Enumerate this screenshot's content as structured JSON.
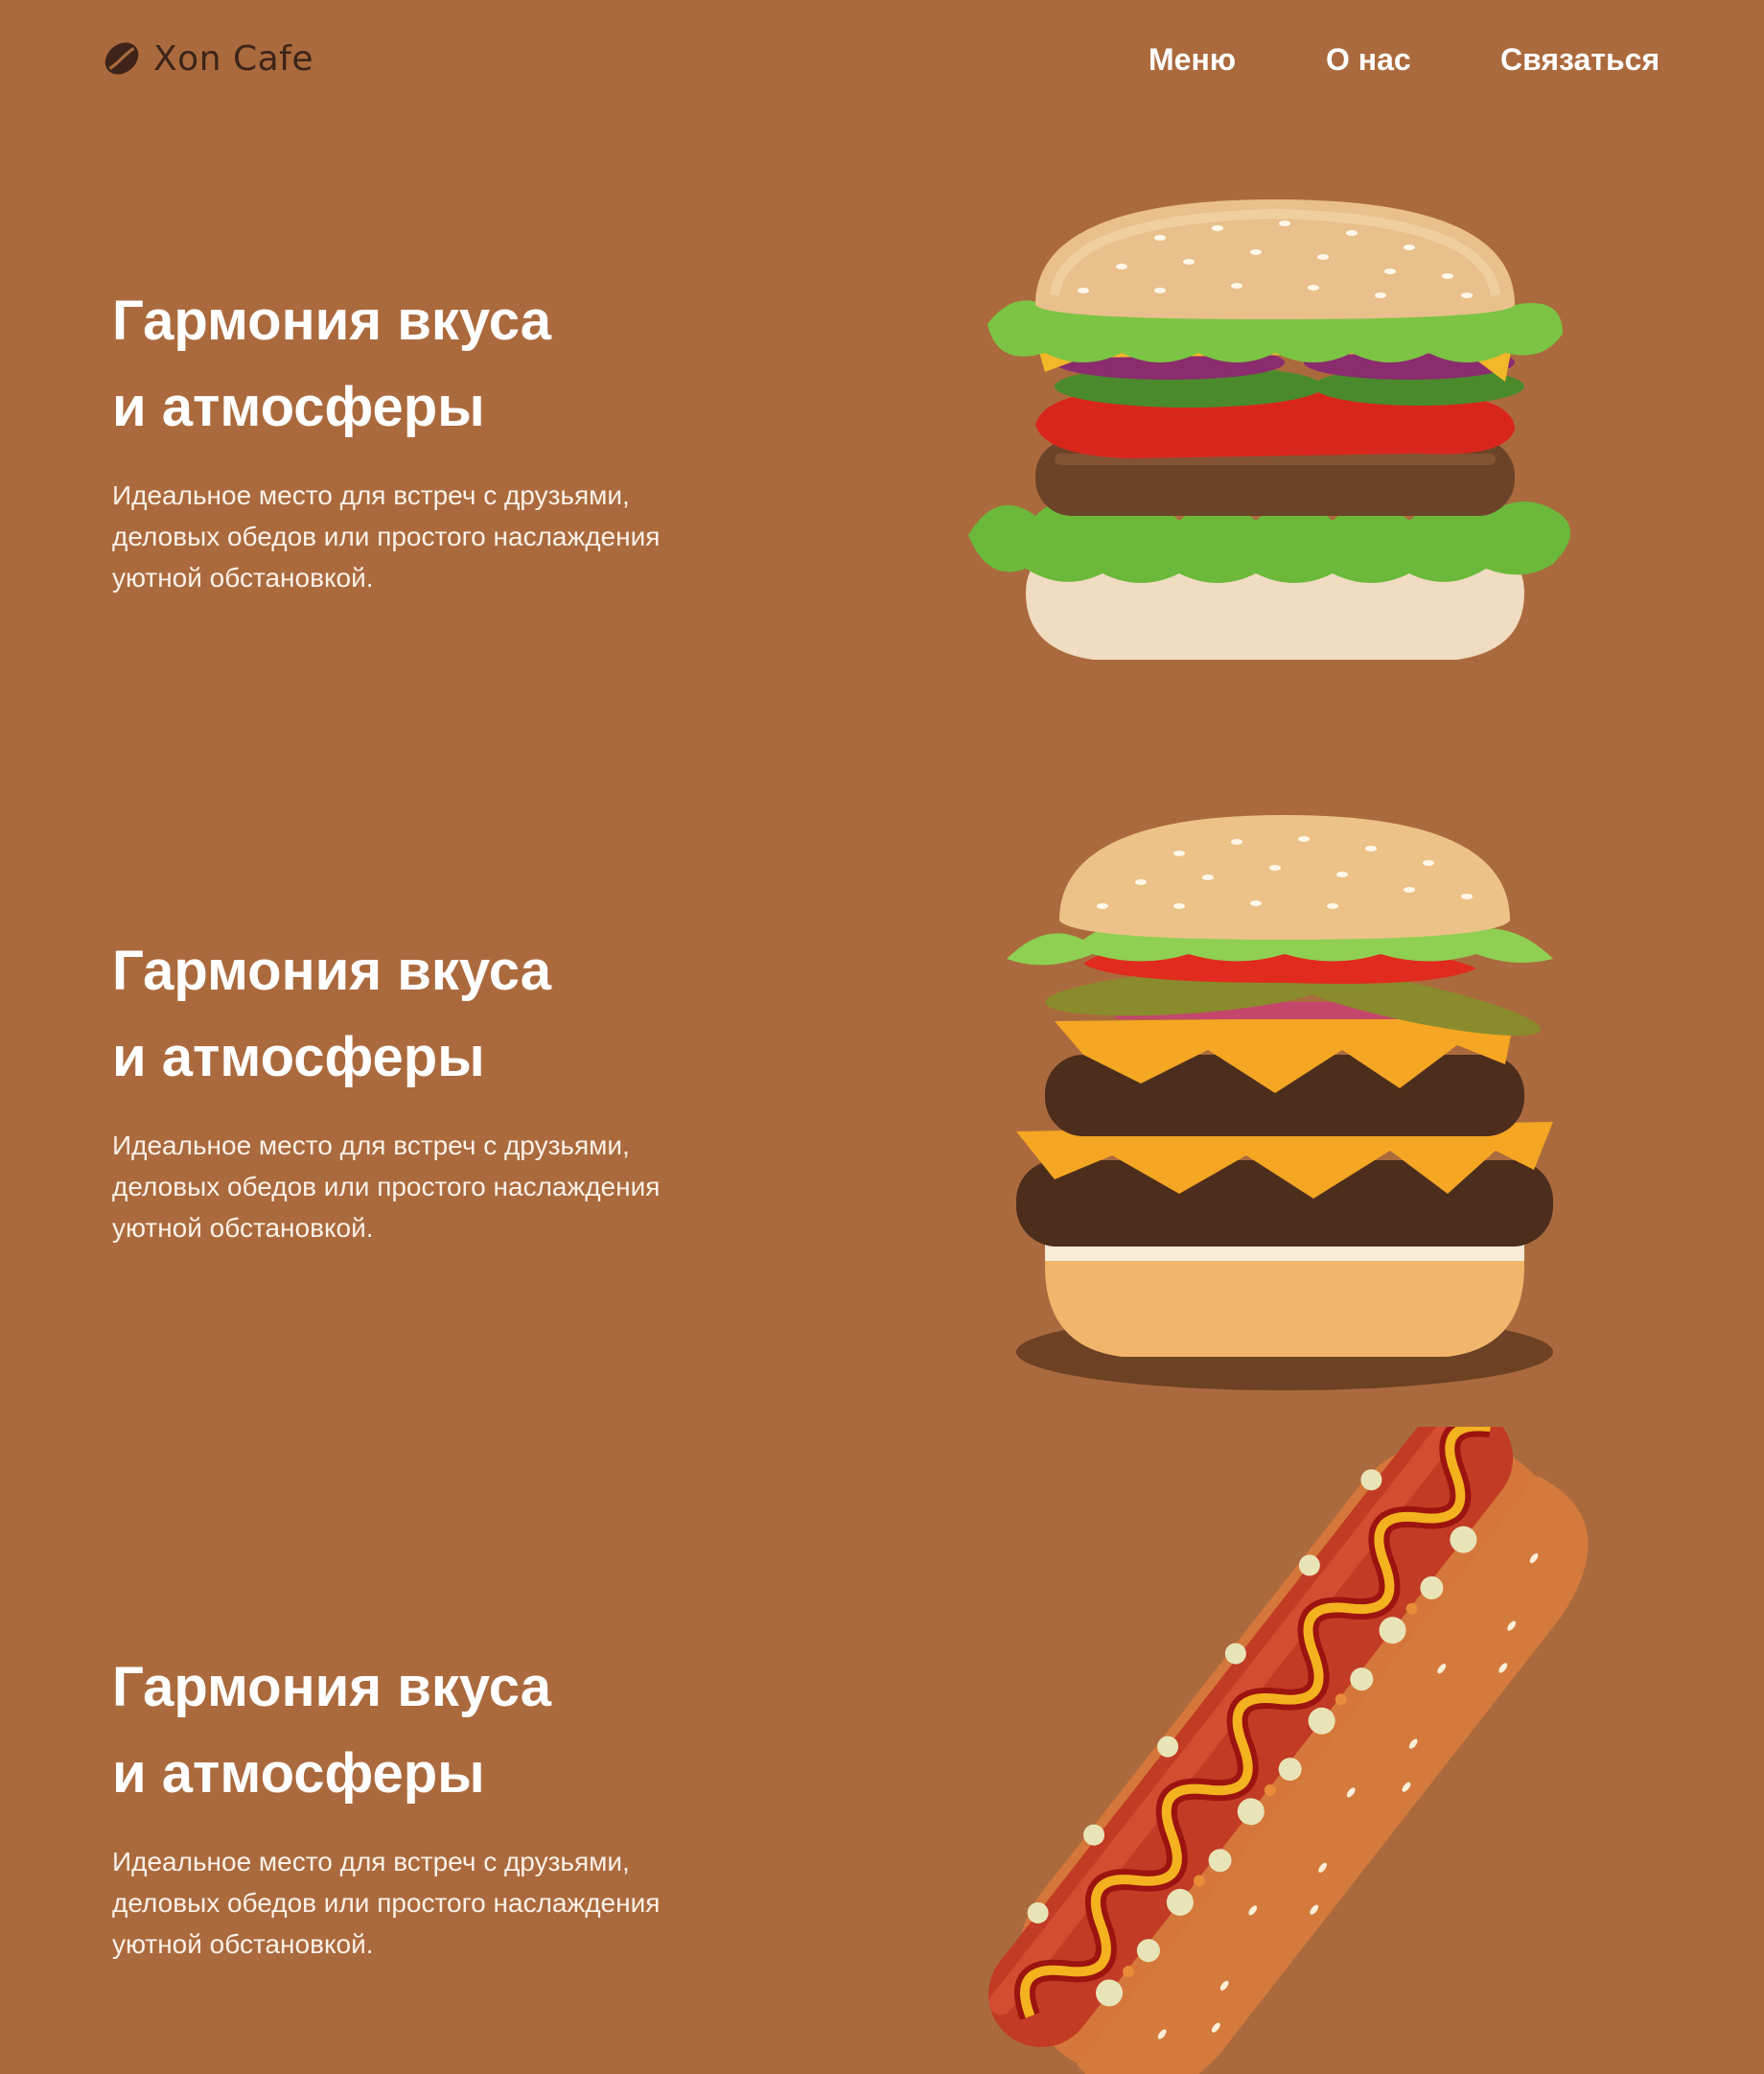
{
  "brand": {
    "name": "Xon Cafe",
    "icon": "coffee-bean-icon"
  },
  "nav": [
    {
      "label": "Меню"
    },
    {
      "label": "О нас"
    },
    {
      "label": "Связаться"
    }
  ],
  "sections": [
    {
      "title_line1": "Гармония вкуса",
      "title_line2": "и атмосферы",
      "desc_line1": "Идеальное место для встреч с друзьями,",
      "desc_line2": "деловых обедов или простого наслаждения",
      "desc_line3": "уютной обстановкой.",
      "image": "burger-image"
    },
    {
      "title_line1": "Гармония вкуса",
      "title_line2": "и атмосферы",
      "desc_line1": "Идеальное место для встреч с друзьями,",
      "desc_line2": "деловых обедов или простого наслаждения",
      "desc_line3": "уютной обстановкой.",
      "image": "cheeseburger-image"
    },
    {
      "title_line1": "Гармония вкуса",
      "title_line2": "и атмосферы",
      "desc_line1": "Идеальное место для встреч с друзьями,",
      "desc_line2": "деловых обедов или простого наслаждения",
      "desc_line3": "уютной обстановкой.",
      "image": "hotdog-image"
    }
  ],
  "colors": {
    "background": "#ab6a3d",
    "logo_text": "#3e2418",
    "text": "#ffffff"
  }
}
